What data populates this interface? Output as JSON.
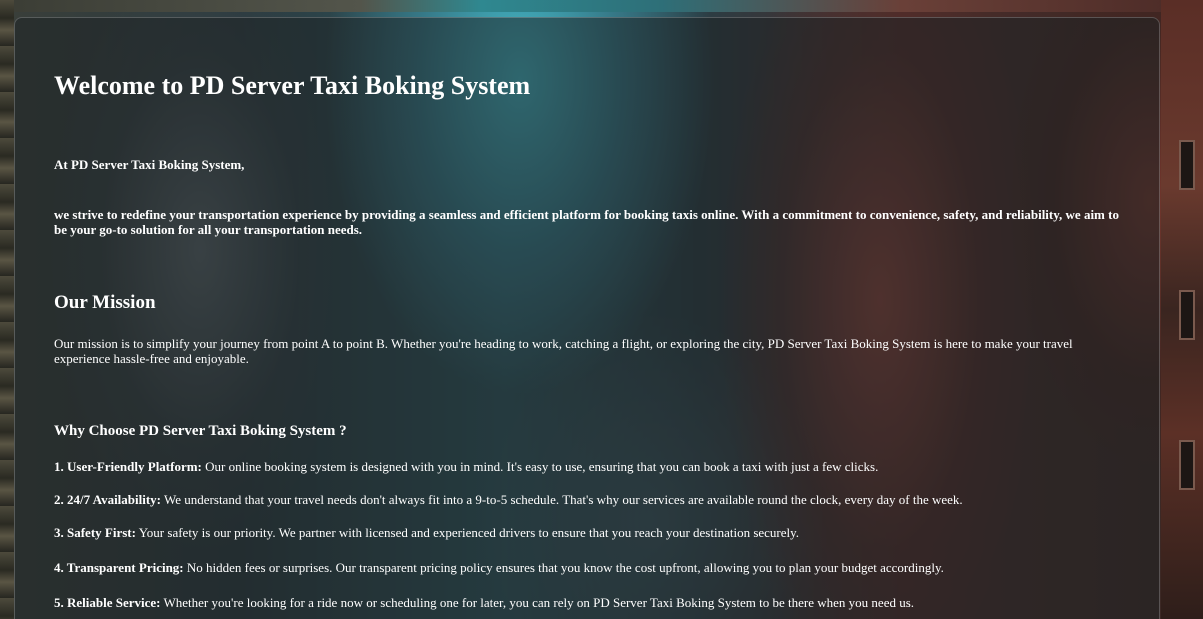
{
  "page": {
    "title": "Welcome to PD Server Taxi Boking System",
    "intro_lead": "At PD Server Taxi Boking System,",
    "intro_body": "we strive to redefine your transportation experience by providing a seamless and efficient platform for booking taxis online. With a commitment to convenience, safety, and reliability, we aim to be your go-to solution for all your transportation needs."
  },
  "mission": {
    "heading": "Our Mission",
    "body": "Our mission is to simplify your journey from point A to point B. Whether you're heading to work, catching a flight, or exploring the city, PD Server Taxi Boking System is here to make your travel experience hassle-free and enjoyable."
  },
  "why": {
    "heading": "Why Choose PD Server Taxi Boking System ?",
    "items": [
      {
        "label": "1. User-Friendly Platform:",
        "text": " Our online booking system is designed with you in mind. It's easy to use, ensuring that you can book a taxi with just a few clicks."
      },
      {
        "label": "2. 24/7 Availability:",
        "text": " We understand that your travel needs don't always fit into a 9-to-5 schedule. That's why our services are available round the clock, every day of the week."
      },
      {
        "label": "3. Safety First:",
        "text": " Your safety is our priority. We partner with licensed and experienced drivers to ensure that you reach your destination securely."
      },
      {
        "label": "4. Transparent Pricing:",
        "text": " No hidden fees or surprises. Our transparent pricing policy ensures that you know the cost upfront, allowing you to plan your budget accordingly."
      },
      {
        "label": "5. Reliable Service:",
        "text": " Whether you're looking for a ride now or scheduling one for later, you can rely on PD Server Taxi Boking System to be there when you need us."
      }
    ]
  },
  "colors": {
    "text": "#ffffff",
    "panel": "#1e2224",
    "accent_teal": "#46bece",
    "accent_brick": "#964640"
  }
}
